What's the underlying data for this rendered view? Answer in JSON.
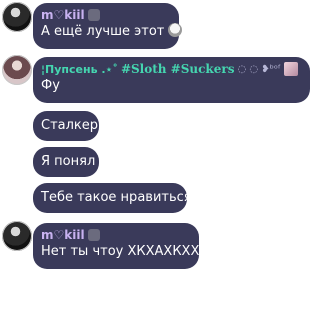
{
  "messages": [
    {
      "author": "m♡kiil",
      "text": "А ещё лучше этот"
    },
    {
      "author": "¦Пупсень .⋆˚",
      "tags": "#Sloth #Suckers",
      "suffix": "◌ ◌ ❥ᵇᵒᶠ",
      "text": "Фу"
    },
    {
      "text": "Сталкер"
    },
    {
      "text": "Я понял"
    },
    {
      "text": "Тебе такое нравиться"
    },
    {
      "author": "m♡kiil",
      "text": "Нет ты чтоу ХКХАХКХХВ"
    }
  ]
}
